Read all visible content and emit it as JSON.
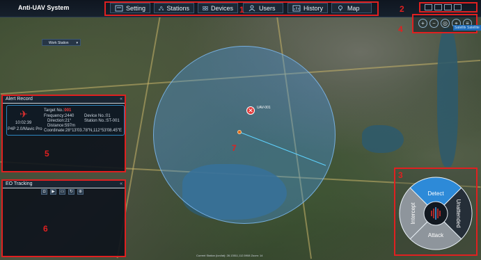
{
  "app": {
    "title": "Anti-UAV System"
  },
  "nav": {
    "items": [
      {
        "label": "Setting",
        "icon": "gear-icon"
      },
      {
        "label": "Stations",
        "icon": "stations-icon"
      },
      {
        "label": "Devices",
        "icon": "devices-icon"
      },
      {
        "label": "Users",
        "icon": "users-icon"
      },
      {
        "label": "History",
        "icon": "history-icon"
      },
      {
        "label": "Map",
        "icon": "map-icon"
      }
    ]
  },
  "annotations": {
    "n1": "1",
    "n2": "2",
    "n3": "3",
    "n4": "4",
    "n5": "5",
    "n6": "6",
    "n7": "7"
  },
  "map": {
    "work_station_label": "Work Station",
    "target_label": "UAV-001",
    "map_types": [
      "Satellite",
      "Satellite"
    ],
    "bottom_info": "Current Station (lon/lat): 28.13511,112.5908  Zoom: 14"
  },
  "alert_record": {
    "title": "Alert Record",
    "time": "10:02:39",
    "model": "P4P 2.0/Mavic Pro",
    "target_no_label": "Target No.:",
    "target_no": "001",
    "frequency": "Frequency:2440",
    "direction": "Direction:21°",
    "distance": "Distance:597m",
    "device_no": "Device No.:01",
    "station_no": "Station No.:ST-001",
    "coordinate": "Coordinate:28°13'03.78\"N,112°53'08.45\"E"
  },
  "eo_tracking": {
    "title": "EO Tracking"
  },
  "control": {
    "detect": "Detect",
    "unattended": "Unattended",
    "attack": "Attack",
    "intercept": "Intercept"
  },
  "colors": {
    "annotation": "#e02020",
    "radar": "#4696e6",
    "detect": "#2d8ad8"
  }
}
